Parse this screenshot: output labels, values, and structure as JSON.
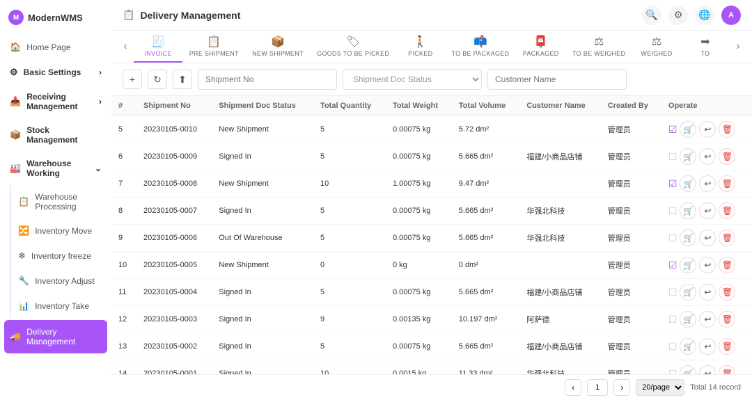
{
  "app": {
    "name": "ModernWMS"
  },
  "sidebar": {
    "home": "Home Page",
    "groups": [
      {
        "label": "Basic Settings",
        "icon": "⚙",
        "expanded": false
      },
      {
        "label": "Receiving Management",
        "icon": "📥",
        "expanded": false
      },
      {
        "label": "Stock Management",
        "icon": "📦",
        "expanded": false
      },
      {
        "label": "Warehouse Working",
        "icon": "🏭",
        "expanded": true,
        "children": [
          "Warehouse Processing",
          "Inventory Move",
          "Inventory freeze",
          "Inventory Adjust",
          "Inventory Take"
        ]
      },
      {
        "label": "Delivery Management",
        "icon": "🚚",
        "active": true
      }
    ]
  },
  "header": {
    "title": "Delivery Management",
    "icon": "📋"
  },
  "tabs": [
    {
      "label": "INVOICE",
      "icon": "🧾"
    },
    {
      "label": "PRE SHIPMENT",
      "icon": "📋"
    },
    {
      "label": "NEW SHIPMENT",
      "icon": "📦"
    },
    {
      "label": "GOODS TO BE PICKED",
      "icon": "🏷"
    },
    {
      "label": "PICKED",
      "icon": "🚶"
    },
    {
      "label": "TO BE PACKAGED",
      "icon": "📫"
    },
    {
      "label": "PACKAGED",
      "icon": "📫"
    },
    {
      "label": "TO BE WEIGHED",
      "icon": "⚖"
    },
    {
      "label": "WEIGHED",
      "icon": "⚖"
    },
    {
      "label": "TO",
      "icon": "➡"
    }
  ],
  "toolbar": {
    "add_title": "+",
    "refresh_title": "↻",
    "export_title": "⬆",
    "shipment_no_placeholder": "Shipment No",
    "shipment_doc_status_placeholder": "Shipment Doc Status",
    "customer_name_placeholder": "Customer Name"
  },
  "table": {
    "columns": [
      "#",
      "Shipment No",
      "Shipment Doc Status",
      "Total Quantity",
      "Total Weight",
      "Total Volume",
      "Customer Name",
      "Created By",
      "Operate"
    ],
    "rows": [
      {
        "id": 5,
        "shipment_no": "20230105-0010",
        "status": "New Shipment",
        "total_qty": 5,
        "total_weight": "0.00075 kg",
        "total_volume": "5.72 dm²",
        "customer": "",
        "created_by": "管理员",
        "checked": true
      },
      {
        "id": 6,
        "shipment_no": "20230105-0009",
        "status": "Signed In",
        "total_qty": 5,
        "total_weight": "0.00075 kg",
        "total_volume": "5.665 dm²",
        "customer": "福建/小商品店铺",
        "created_by": "管理员",
        "checked": false
      },
      {
        "id": 7,
        "shipment_no": "20230105-0008",
        "status": "New Shipment",
        "total_qty": 10,
        "total_weight": "1.00075 kg",
        "total_volume": "9.47 dm²",
        "customer": "",
        "created_by": "管理员",
        "checked": true
      },
      {
        "id": 8,
        "shipment_no": "20230105-0007",
        "status": "Signed In",
        "total_qty": 5,
        "total_weight": "0.00075 kg",
        "total_volume": "5.665 dm²",
        "customer": "华强北科技",
        "created_by": "管理员",
        "checked": false
      },
      {
        "id": 9,
        "shipment_no": "20230105-0006",
        "status": "Out Of Warehouse",
        "total_qty": 5,
        "total_weight": "0.00075 kg",
        "total_volume": "5.665 dm²",
        "customer": "华强北科技",
        "created_by": "管理员",
        "checked": false
      },
      {
        "id": 10,
        "shipment_no": "20230105-0005",
        "status": "New Shipment",
        "total_qty": 0,
        "total_weight": "0 kg",
        "total_volume": "0 dm²",
        "customer": "",
        "created_by": "管理员",
        "checked": true
      },
      {
        "id": 11,
        "shipment_no": "20230105-0004",
        "status": "Signed In",
        "total_qty": 5,
        "total_weight": "0.00075 kg",
        "total_volume": "5.665 dm²",
        "customer": "福建/小商品店铺",
        "created_by": "管理员",
        "checked": false
      },
      {
        "id": 12,
        "shipment_no": "20230105-0003",
        "status": "Signed In",
        "total_qty": 9,
        "total_weight": "0.00135 kg",
        "total_volume": "10.197 dm²",
        "customer": "阿萨德",
        "created_by": "管理员",
        "checked": false
      },
      {
        "id": 13,
        "shipment_no": "20230105-0002",
        "status": "Signed In",
        "total_qty": 5,
        "total_weight": "0.00075 kg",
        "total_volume": "5.665 dm²",
        "customer": "福建/小商品店铺",
        "created_by": "管理员",
        "checked": false
      },
      {
        "id": 14,
        "shipment_no": "20230105-0001",
        "status": "Signed In",
        "total_qty": 10,
        "total_weight": "0.0015 kg",
        "total_volume": "11.33 dm²",
        "customer": "华强北科技",
        "created_by": "管理员",
        "checked": false
      }
    ]
  },
  "pagination": {
    "current_page": 1,
    "page_size": "20/page",
    "total": "Total 14 record"
  }
}
